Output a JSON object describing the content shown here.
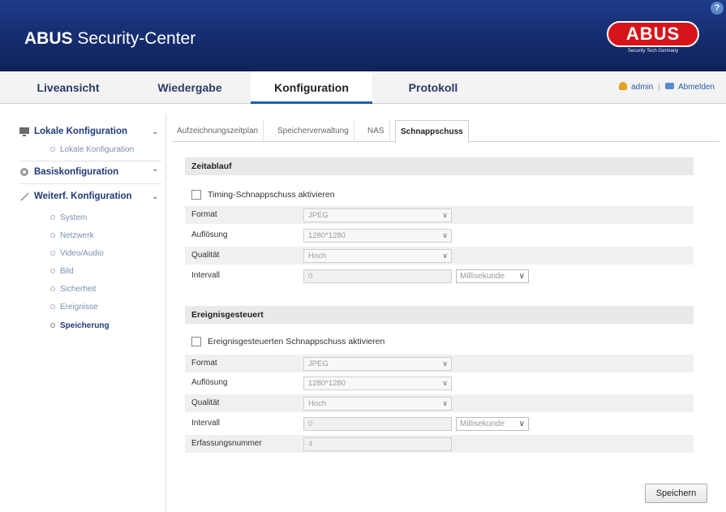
{
  "header": {
    "title_bold": "ABUS",
    "title_rest": " Security-Center",
    "logo_text": "ABUS",
    "logo_subtitle": "Security Tech Germany",
    "help_label": "?"
  },
  "nav": {
    "tabs": [
      {
        "label": "Liveansicht"
      },
      {
        "label": "Wiedergabe"
      },
      {
        "label": "Konfiguration"
      },
      {
        "label": "Protokoll"
      }
    ],
    "active_tab": "Konfiguration",
    "user": "admin",
    "separator": "|",
    "logout": "Abmelden"
  },
  "sidebar": {
    "groups": [
      {
        "label": "Lokale Konfiguration",
        "chevron": "⌄"
      },
      {
        "label": "Basiskonfiguration",
        "chevron": "⌃"
      },
      {
        "label": "Weiterf. Konfiguration",
        "chevron": "⌄"
      }
    ],
    "local_items": [
      {
        "label": "Lokale Konfiguration"
      }
    ],
    "advanced_items": [
      {
        "label": "System"
      },
      {
        "label": "Netzwerk"
      },
      {
        "label": "Video/Audio"
      },
      {
        "label": "Bild"
      },
      {
        "label": "Sicherheit"
      },
      {
        "label": "Ereignisse"
      },
      {
        "label": "Speicherung"
      }
    ],
    "active_item": "Speicherung"
  },
  "tabs": [
    {
      "label": "Aufzeichnungszeitplan"
    },
    {
      "label": "Speicherverwaltung"
    },
    {
      "label": "NAS"
    },
    {
      "label": "Schnappschuss"
    }
  ],
  "active_tab": "Schnappschuss",
  "timing": {
    "title": "Zeitablauf",
    "enable_label": "Timing-Schnappschuss aktivieren",
    "format_label": "Format",
    "format_value": "JPEG",
    "resolution_label": "Auflösung",
    "resolution_value": "1280*1280",
    "quality_label": "Qualität",
    "quality_value": "Hoch",
    "interval_label": "Intervall",
    "interval_value": "0",
    "interval_unit": "Millisekunde"
  },
  "event": {
    "title": "Ereignisgesteuert",
    "enable_label": "Ereignisgesteuerten Schnappschuss aktivieren",
    "format_label": "Format",
    "format_value": "JPEG",
    "resolution_label": "Auflösung",
    "resolution_value": "1280*1280",
    "quality_label": "Qualität",
    "quality_value": "Hoch",
    "interval_label": "Intervall",
    "interval_value": "0",
    "interval_unit": "Millisekunde",
    "count_label": "Erfassungsnummer",
    "count_value": "4"
  },
  "save_label": "Speichern",
  "colors": {
    "header_bg": "#1a3580",
    "brand_red": "#d7141a",
    "nav_text": "#2b3a67",
    "accent": "#1e5fb4"
  },
  "icons": {
    "help": "help-icon",
    "user": "user-icon",
    "logout": "logout-icon",
    "local_config": "monitor-icon",
    "basic_config": "gear-icon",
    "advanced_config": "wrench-icon",
    "dropdown": "chevron-down-icon"
  }
}
